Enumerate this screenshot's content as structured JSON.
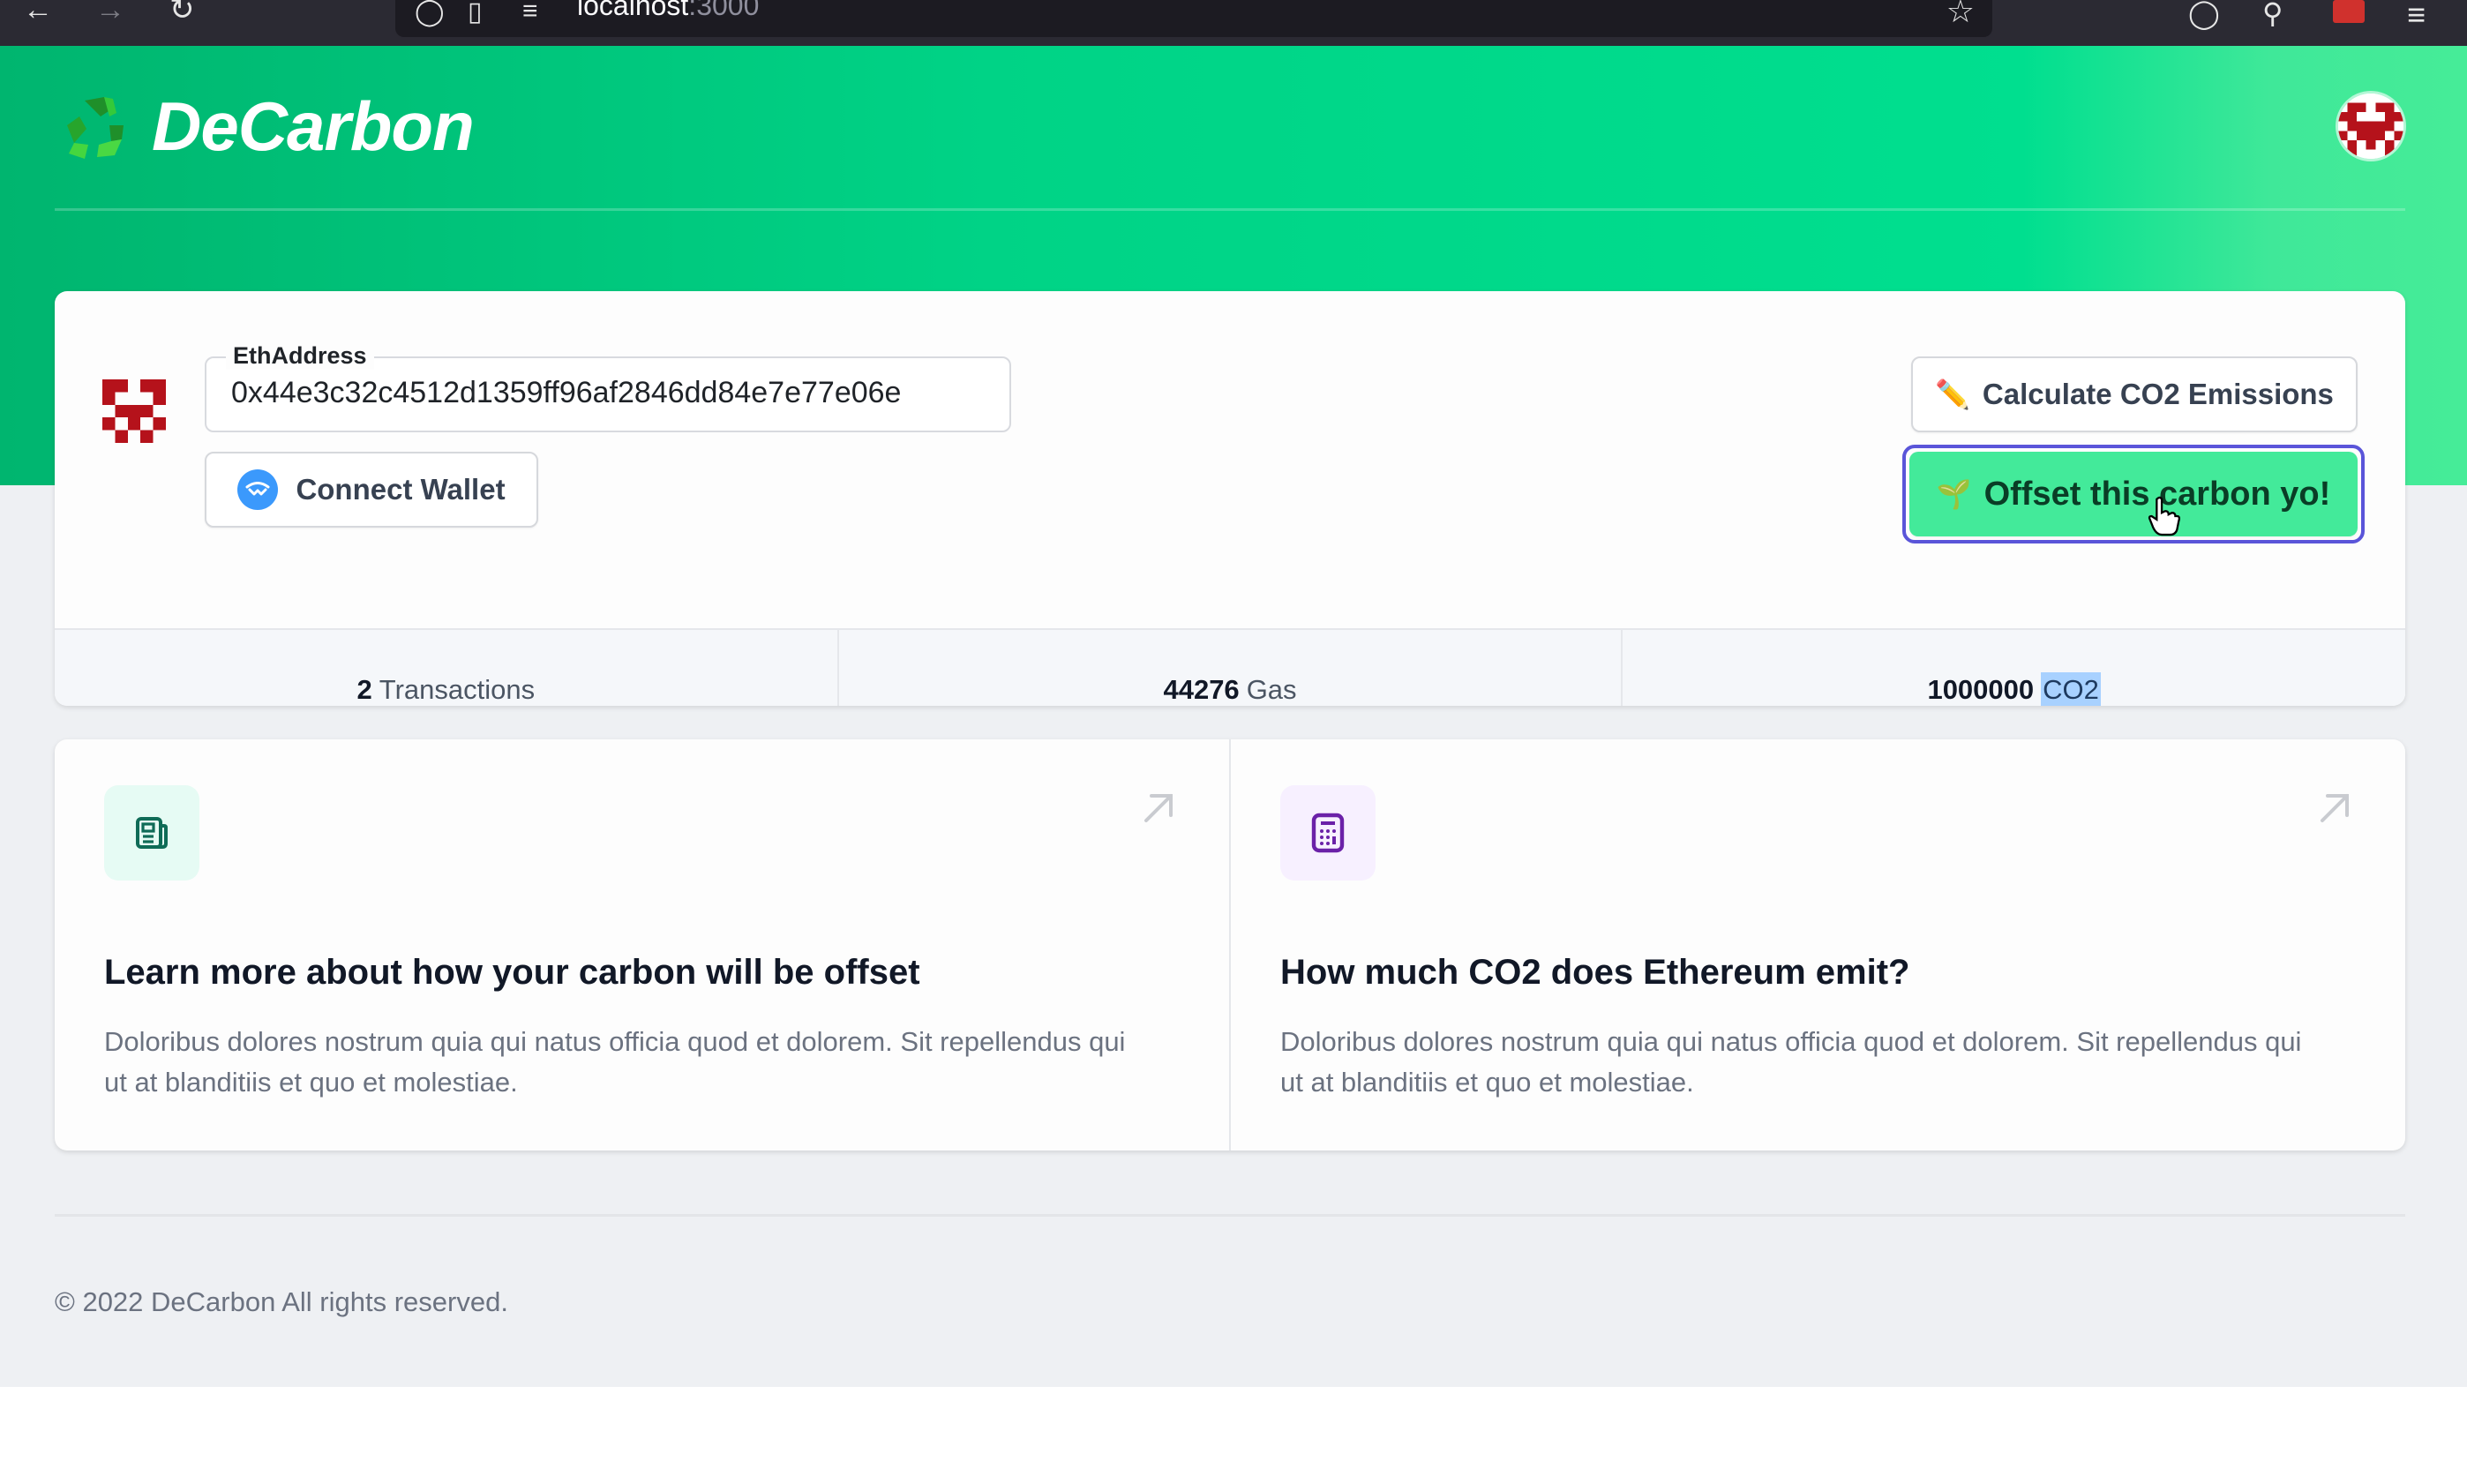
{
  "browser": {
    "url_host": "localhost",
    "url_port": ":3000",
    "icons": [
      "back-icon",
      "forward-icon",
      "reload-icon",
      "shield-icon",
      "page-icon",
      "site-settings-icon",
      "bookmark-star-icon",
      "pocket-icon",
      "key-icon",
      "extension-icon",
      "menu-icon"
    ]
  },
  "header": {
    "brand": "DeCarbon",
    "logo_icon": "recycle-icon",
    "hero_gradient": [
      "#00b56f",
      "#00df8f",
      "#46ec98"
    ]
  },
  "wallet": {
    "field_label": "EthAddress",
    "field_value": "0x44e3c32c4512d1359ff96af2846dd84e7e77e06e",
    "connect_label": "Connect Wallet",
    "connect_icon": "walletconnect-icon"
  },
  "actions": {
    "calculate_emoji": "✏️",
    "calculate_label": "Calculate CO2 Emissions",
    "offset_emoji": "🌱",
    "offset_label": "Offset this carbon yo!",
    "offset_color": "#43ea9a",
    "focus_ring_color": "#5a55d9"
  },
  "stats": [
    {
      "value": "2",
      "unit": "Transactions"
    },
    {
      "value": "44276",
      "unit": "Gas"
    },
    {
      "value": "1000000",
      "unit": "CO2"
    }
  ],
  "features": [
    {
      "icon": "newspaper-icon",
      "icon_color": "#0f6b57",
      "icon_bg": "#e6fbf4",
      "title": "Learn more about how your carbon will be offset",
      "body": "Doloribus dolores nostrum quia qui natus officia quod et dolorem. Sit repellendus qui ut at blanditiis et quo et molestiae."
    },
    {
      "icon": "calculator-icon",
      "icon_color": "#6b21a8",
      "icon_bg": "#f7f0ff",
      "title": "How much CO2 does Ethereum emit?",
      "body": "Doloribus dolores nostrum quia qui natus officia quod et dolorem. Sit repellendus qui ut at blanditiis et quo et molestiae."
    }
  ],
  "footer": {
    "copyright": "© 2022 DeCarbon All rights reserved."
  }
}
